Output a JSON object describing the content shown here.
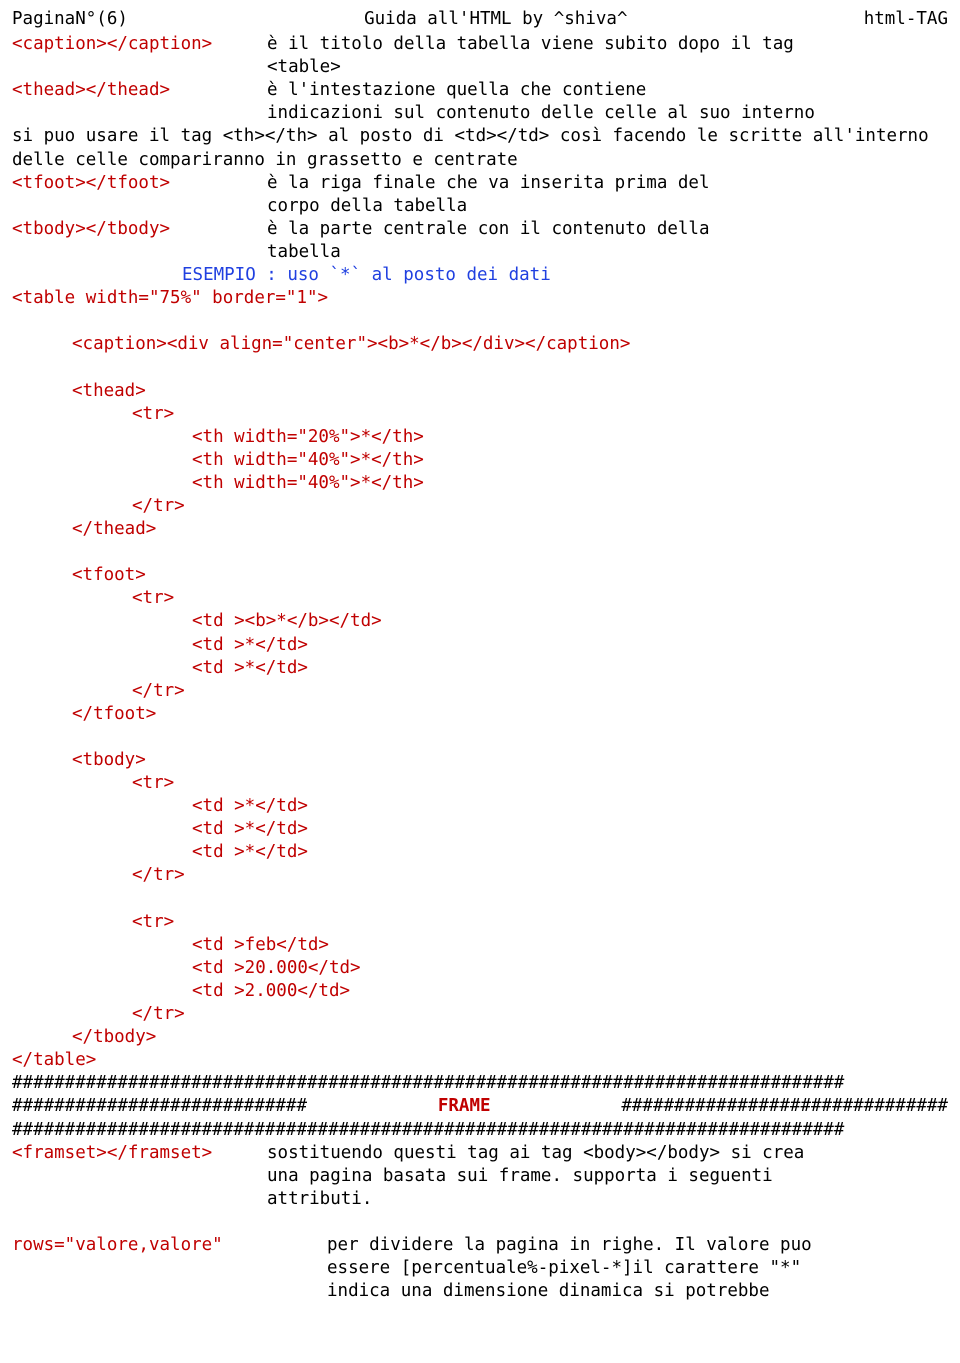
{
  "header": {
    "left": "PaginaN°(6)",
    "center": "Guida all'HTML by ^shiva^",
    "right": "html-TAG"
  },
  "caption": {
    "tag": "<caption></caption>",
    "desc1": "è il titolo della tabella viene subito dopo il tag",
    "desc2": "<table>"
  },
  "thead": {
    "tag": "<thead></thead>",
    "desc1": "è l'intestazione quella che contiene",
    "desc2": "indicazioni sul contenuto delle celle al suo interno"
  },
  "thline": "si puo usare il tag <th></th> al posto di <td></td> così facendo le scritte all'interno delle celle compariranno in grassetto e centrate",
  "tfoot": {
    "tag": "<tfoot></tfoot>",
    "desc1": "è la riga finale che va inserita prima del",
    "desc2": "corpo della tabella"
  },
  "tbody": {
    "tag": "<tbody></tbody>",
    "desc1": "è la parte centrale con il contenuto della",
    "desc2": "tabella"
  },
  "esempio": "ESEMPIO : uso `*`  al posto dei dati",
  "tableopen": "<table width=\"75%\" border=\"1\">",
  "captionline": "<caption><div align=\"center\"><b>*</b></div></caption>",
  "theadopen": "<thead>",
  "tr": "<tr>",
  "th20": "<th width=\"20%\">*</th>",
  "th40a": "<th width=\"40%\">*</th>",
  "th40b": "<th width=\"40%\">*</th>",
  "trclose": "</tr>",
  "theadclose": "</thead>",
  "tfootopen": "<tfoot>",
  "tdb": "<td ><b>*</b></td>",
  "tdstar": "<td >*</td>",
  "tfootclose": "</tfoot>",
  "tbodyopen": "<tbody>",
  "tdfeb": "<td >feb</td>",
  "td20k": "<td >20.000</td>",
  "td2k": "<td >2.000</td>",
  "tbodyclose": "</tbody>",
  "tableclose": "</table>",
  "hashfull1": "###############################################################################",
  "hashleft": "############################",
  "frame": "FRAME",
  "hashright": "###############################",
  "hashfull2": "###############################################################################",
  "frameset": {
    "tag": "<framset></framset>",
    "desc1": "sostituendo questi tag  ai tag <body></body> si crea",
    "desc2": "una pagina basata sui frame. supporta i seguenti",
    "desc3": "attributi."
  },
  "rows": {
    "tag": "rows=\"valore,valore\"",
    "desc1": "per dividere la pagina in righe. Il valore puo",
    "desc2": "essere [percentuale%-pixel-*]il carattere \"*\"",
    "desc3": "indica una dimensione dinamica si potrebbe"
  }
}
